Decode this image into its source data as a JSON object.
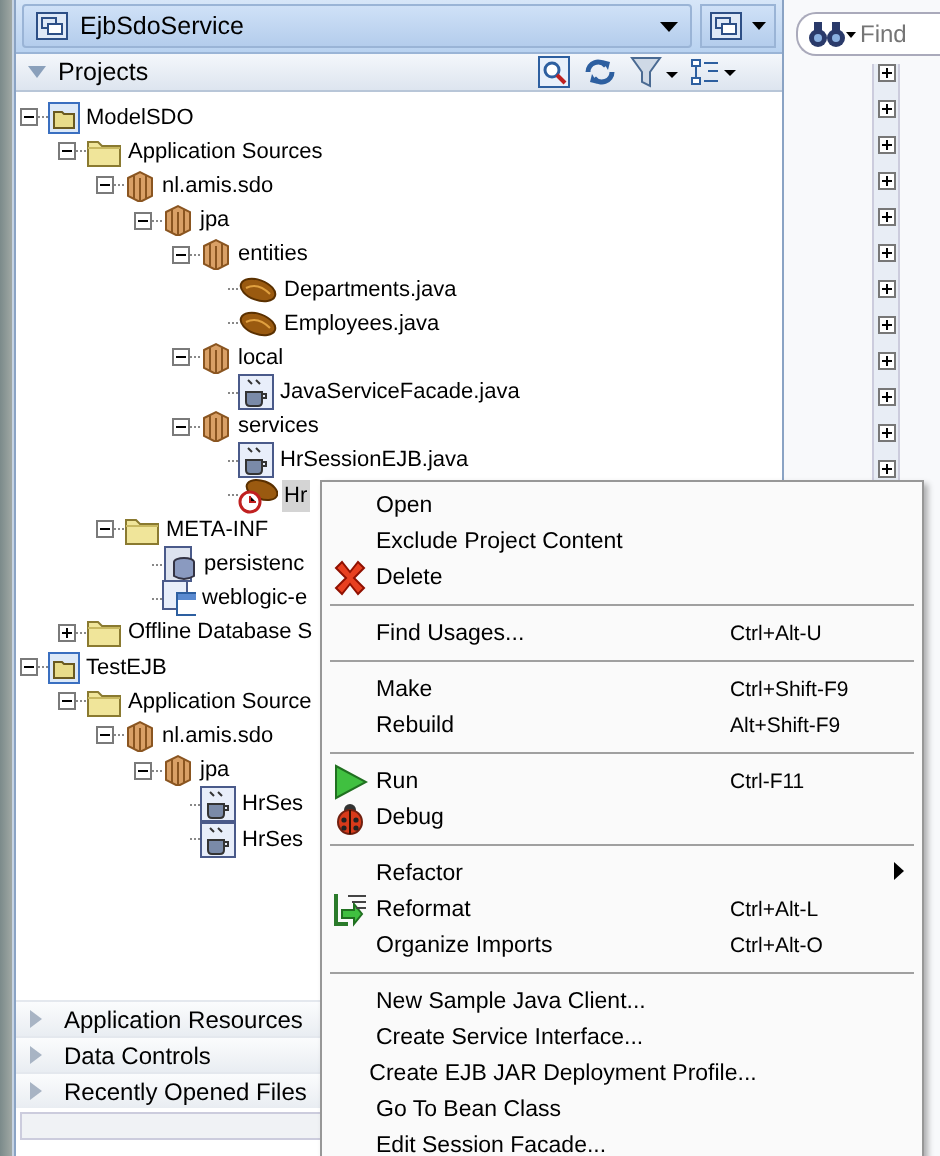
{
  "panel": {
    "title": "EjbSdoService"
  },
  "search": {
    "placeholder": "Find"
  },
  "projects": {
    "title": "Projects",
    "expanded": true
  },
  "tree": [
    {
      "label": "ModelSDO",
      "kind": "project",
      "expanded": true,
      "selected": false,
      "children": [
        {
          "label": "Application Sources",
          "kind": "folder",
          "expanded": true,
          "selected": false,
          "children": [
            {
              "label": "nl.amis.sdo",
              "kind": "package",
              "expanded": true,
              "selected": false,
              "children": [
                {
                  "label": "jpa",
                  "kind": "package",
                  "expanded": true,
                  "selected": false,
                  "children": [
                    {
                      "label": "entities",
                      "kind": "package",
                      "expanded": true,
                      "selected": false,
                      "children": [
                        {
                          "label": "Departments.java",
                          "kind": "bean",
                          "selected": false
                        },
                        {
                          "label": "Employees.java",
                          "kind": "bean",
                          "selected": false
                        }
                      ]
                    },
                    {
                      "label": "local",
                      "kind": "package",
                      "expanded": true,
                      "selected": false,
                      "children": [
                        {
                          "label": "JavaServiceFacade.java",
                          "kind": "java",
                          "selected": false
                        }
                      ]
                    },
                    {
                      "label": "services",
                      "kind": "package",
                      "expanded": true,
                      "selected": false,
                      "children": [
                        {
                          "label": "HrSessionEJB.java",
                          "kind": "java",
                          "selected": false
                        },
                        {
                          "label": "Hr",
                          "kind": "timer-bean",
                          "selected": true
                        }
                      ]
                    }
                  ]
                }
              ]
            },
            {
              "label": "META-INF",
              "kind": "folder",
              "expanded": true,
              "selected": false,
              "children": [
                {
                  "label": "persistenc",
                  "kind": "db-file",
                  "selected": false
                },
                {
                  "label": "weblogic-e",
                  "kind": "web-file",
                  "selected": false
                }
              ]
            }
          ]
        },
        {
          "label": "Offline Database S",
          "kind": "folder",
          "expanded": false,
          "selected": false
        }
      ]
    },
    {
      "label": "TestEJB",
      "kind": "project",
      "expanded": true,
      "selected": false,
      "children": [
        {
          "label": "Application Source",
          "kind": "folder",
          "expanded": true,
          "selected": false,
          "children": [
            {
              "label": "nl.amis.sdo",
              "kind": "package",
              "expanded": true,
              "selected": false,
              "children": [
                {
                  "label": "jpa",
                  "kind": "package",
                  "expanded": true,
                  "selected": false,
                  "children": [
                    {
                      "label": "HrSes",
                      "kind": "java",
                      "selected": false
                    },
                    {
                      "label": "HrSes",
                      "kind": "java",
                      "selected": false
                    }
                  ]
                }
              ]
            }
          ]
        }
      ]
    }
  ],
  "accordion": [
    {
      "label": "Application Resources",
      "expanded": false
    },
    {
      "label": "Data Controls",
      "expanded": false
    },
    {
      "label": "Recently Opened Files",
      "expanded": false
    }
  ],
  "context_menu": {
    "groups": [
      [
        {
          "label": "Open"
        },
        {
          "label": "Exclude Project Content"
        },
        {
          "label": "Delete",
          "kind": "delete"
        }
      ],
      [
        {
          "label": "Find Usages...",
          "shortcut": "Ctrl+Alt-U"
        }
      ],
      [
        {
          "label": "Make",
          "shortcut": "Ctrl+Shift-F9"
        },
        {
          "label": "Rebuild",
          "shortcut": "Alt+Shift-F9"
        }
      ],
      [
        {
          "label": "Run",
          "shortcut": "Ctrl-F11",
          "kind": "run"
        },
        {
          "label": "Debug",
          "kind": "debug"
        }
      ],
      [
        {
          "label": "Refactor",
          "submenu": true
        },
        {
          "label": "Reformat",
          "shortcut": "Ctrl+Alt-L",
          "kind": "reformat"
        },
        {
          "label": "Organize Imports",
          "shortcut": "Ctrl+Alt-O"
        }
      ],
      [
        {
          "label": "New Sample Java Client..."
        },
        {
          "label": "Create Service Interface..."
        },
        {
          "label": "Create EJB JAR Deployment Profile..."
        },
        {
          "label": "Go To Bean Class"
        },
        {
          "label": "Edit Session Facade..."
        }
      ]
    ]
  }
}
